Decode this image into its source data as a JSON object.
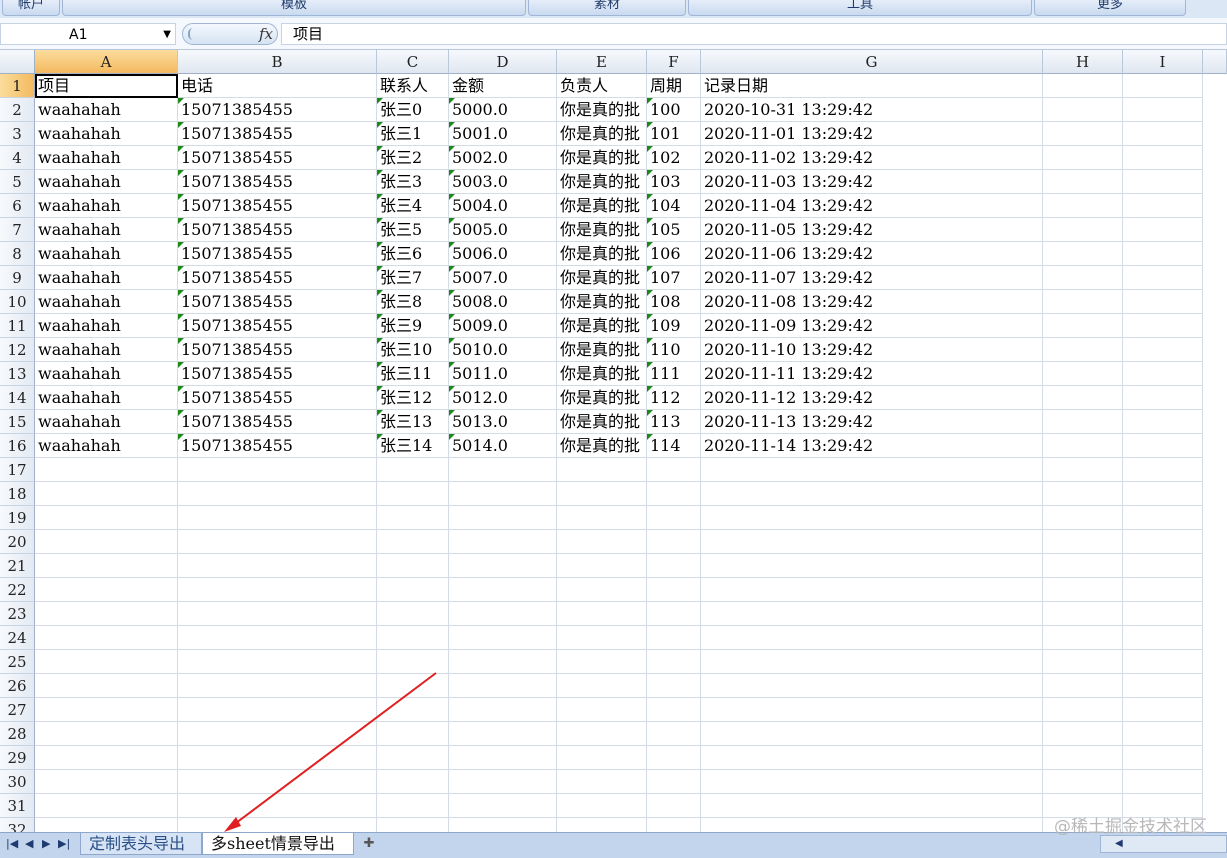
{
  "ribbon": {
    "tabs": [
      "帐户",
      "模板",
      "素材",
      "工具",
      "更多"
    ]
  },
  "formula_bar": {
    "name_box": "A1",
    "fx_label": "fx",
    "content": "项目"
  },
  "columns": [
    "A",
    "B",
    "C",
    "D",
    "E",
    "F",
    "G",
    "H",
    "I"
  ],
  "selected_column": "A",
  "selected_row": 1,
  "rows": [
    [
      "项目",
      "电话",
      "联系人",
      "金额",
      "负责人",
      "周期",
      "记录日期"
    ],
    [
      "waahahah",
      "15071385455",
      "张三0",
      "5000.0",
      "你是真的批",
      "100",
      "2020-10-31 13:29:42"
    ],
    [
      "waahahah",
      "15071385455",
      "张三1",
      "5001.0",
      "你是真的批",
      "101",
      "2020-11-01 13:29:42"
    ],
    [
      "waahahah",
      "15071385455",
      "张三2",
      "5002.0",
      "你是真的批",
      "102",
      "2020-11-02 13:29:42"
    ],
    [
      "waahahah",
      "15071385455",
      "张三3",
      "5003.0",
      "你是真的批",
      "103",
      "2020-11-03 13:29:42"
    ],
    [
      "waahahah",
      "15071385455",
      "张三4",
      "5004.0",
      "你是真的批",
      "104",
      "2020-11-04 13:29:42"
    ],
    [
      "waahahah",
      "15071385455",
      "张三5",
      "5005.0",
      "你是真的批",
      "105",
      "2020-11-05 13:29:42"
    ],
    [
      "waahahah",
      "15071385455",
      "张三6",
      "5006.0",
      "你是真的批",
      "106",
      "2020-11-06 13:29:42"
    ],
    [
      "waahahah",
      "15071385455",
      "张三7",
      "5007.0",
      "你是真的批",
      "107",
      "2020-11-07 13:29:42"
    ],
    [
      "waahahah",
      "15071385455",
      "张三8",
      "5008.0",
      "你是真的批",
      "108",
      "2020-11-08 13:29:42"
    ],
    [
      "waahahah",
      "15071385455",
      "张三9",
      "5009.0",
      "你是真的批",
      "109",
      "2020-11-09 13:29:42"
    ],
    [
      "waahahah",
      "15071385455",
      "张三10",
      "5010.0",
      "你是真的批",
      "110",
      "2020-11-10 13:29:42"
    ],
    [
      "waahahah",
      "15071385455",
      "张三11",
      "5011.0",
      "你是真的批",
      "111",
      "2020-11-11 13:29:42"
    ],
    [
      "waahahah",
      "15071385455",
      "张三12",
      "5012.0",
      "你是真的批",
      "112",
      "2020-11-12 13:29:42"
    ],
    [
      "waahahah",
      "15071385455",
      "张三13",
      "5013.0",
      "你是真的批",
      "113",
      "2020-11-13 13:29:42"
    ],
    [
      "waahahah",
      "15071385455",
      "张三14",
      "5014.0",
      "你是真的批",
      "114",
      "2020-11-14 13:29:42"
    ]
  ],
  "visible_row_count": 32,
  "sheet_tabs": [
    "定制表头导出",
    "多sheet情景导出"
  ],
  "active_sheet": 1,
  "watermark": "@稀土掘金技术社区",
  "colors": {
    "accent": "#f4b960",
    "error_triangle": "#1a8a1a",
    "arrow": "#e02020"
  }
}
